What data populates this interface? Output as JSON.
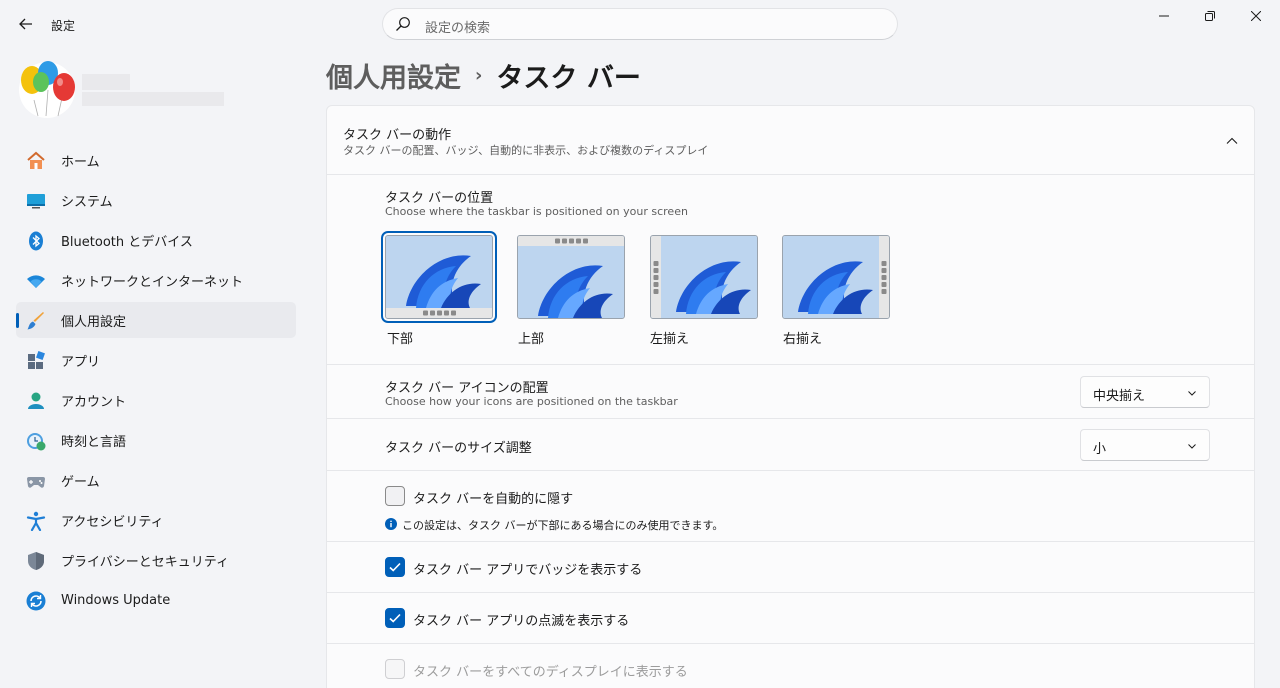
{
  "window": {
    "title": "設定"
  },
  "search": {
    "placeholder": "設定の検索"
  },
  "sidebar": {
    "items": [
      {
        "label": "ホーム",
        "icon": "home-icon"
      },
      {
        "label": "システム",
        "icon": "system-icon"
      },
      {
        "label": "Bluetooth とデバイス",
        "icon": "bluetooth-icon"
      },
      {
        "label": "ネットワークとインターネット",
        "icon": "wifi-icon"
      },
      {
        "label": "個人用設定",
        "icon": "brush-icon",
        "active": true
      },
      {
        "label": "アプリ",
        "icon": "apps-icon"
      },
      {
        "label": "アカウント",
        "icon": "account-icon"
      },
      {
        "label": "時刻と言語",
        "icon": "time-language-icon"
      },
      {
        "label": "ゲーム",
        "icon": "gamepad-icon"
      },
      {
        "label": "アクセシビリティ",
        "icon": "accessibility-icon"
      },
      {
        "label": "プライバシーとセキュリティ",
        "icon": "shield-icon"
      },
      {
        "label": "Windows Update",
        "icon": "update-icon"
      }
    ]
  },
  "header": {
    "parent": "個人用設定",
    "separator": "›",
    "current": "タスク バー"
  },
  "behavior": {
    "title": "タスク バーの動作",
    "subtitle": "タスク バーの配置、バッジ、自動的に非表示、および複数のディスプレイ"
  },
  "position": {
    "title": "タスク バーの位置",
    "subtitle": "Choose where the taskbar is positioned on your screen",
    "options": [
      {
        "label": "下部",
        "selected": true
      },
      {
        "label": "上部"
      },
      {
        "label": "左揃え"
      },
      {
        "label": "右揃え"
      }
    ]
  },
  "alignment": {
    "title": "タスク バー アイコンの配置",
    "subtitle": "Choose how your icons are positioned on the taskbar",
    "value": "中央揃え"
  },
  "size": {
    "title": "タスク バーのサイズ調整",
    "value": "小"
  },
  "autohide": {
    "label": "タスク バーを自動的に隠す",
    "checked": false,
    "note": "この設定は、タスク バーが下部にある場合にのみ使用できます。"
  },
  "badges": {
    "label": "タスク バー アプリでバッジを表示する",
    "checked": true
  },
  "flashing": {
    "label": "タスク バー アプリの点滅を表示する",
    "checked": true
  },
  "all_displays": {
    "label": "タスク バーをすべてのディスプレイに表示する",
    "checked": false,
    "disabled": true
  },
  "colors": {
    "accent": "#005fb8",
    "background": "#f3f4f7",
    "card": "#fbfbfc"
  }
}
